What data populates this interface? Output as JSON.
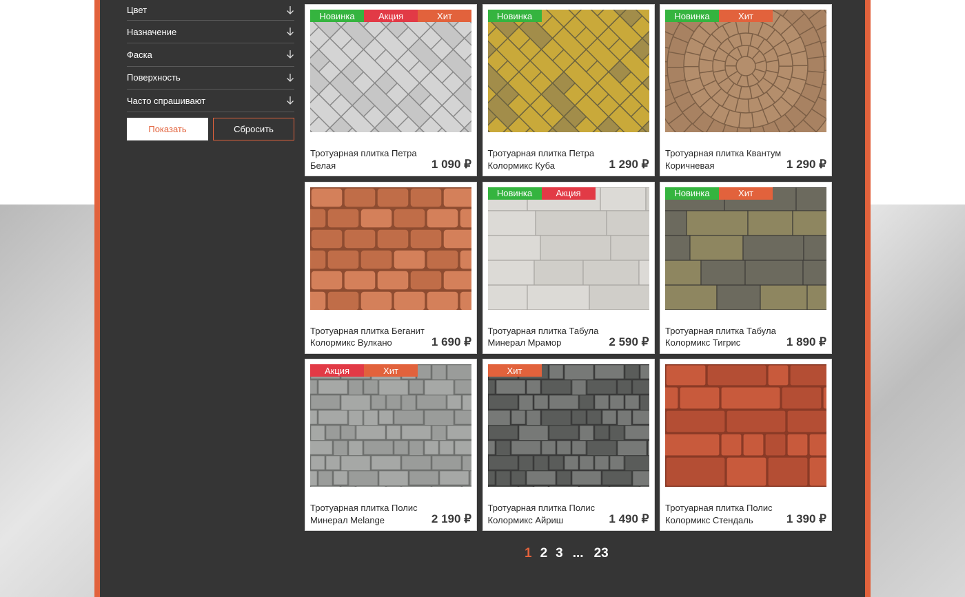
{
  "filters": [
    {
      "label": "Цвет"
    },
    {
      "label": "Назначение"
    },
    {
      "label": "Фаска"
    },
    {
      "label": "Поверхность"
    },
    {
      "label": "Часто спрашивают"
    }
  ],
  "buttons": {
    "show": "Показать",
    "reset": "Сбросить"
  },
  "badge_labels": {
    "new": "Новинка",
    "sale": "Акция",
    "hit": "Хит"
  },
  "products": [
    {
      "title": "Тротуарная плитка Петра Белая",
      "price": "1 090 ₽",
      "badges": [
        "new",
        "sale",
        "hit"
      ],
      "pattern": "herringbone",
      "colors": [
        "#d4d4d4",
        "#c6c6c6",
        "#8a8a8a"
      ]
    },
    {
      "title": "Тротуарная плитка Петра Колормикс Куба",
      "price": "1 290 ₽",
      "badges": [
        "new"
      ],
      "pattern": "herringbone",
      "colors": [
        "#c9a93a",
        "#a28d4a",
        "#6d6440"
      ]
    },
    {
      "title": "Тротуарная плитка Квантум Коричневая",
      "price": "1 290 ₽",
      "badges": [
        "new",
        "hit"
      ],
      "pattern": "circle",
      "colors": [
        "#b48e6c",
        "#a88262",
        "#7c5f46"
      ]
    },
    {
      "title": "Тротуарная плитка Беганит Колормикс Вулкано",
      "price": "1 690 ₽",
      "badges": [],
      "pattern": "brick",
      "colors": [
        "#d4805a",
        "#c06d48",
        "#8e4c31"
      ]
    },
    {
      "title": "Тротуарная плитка Табула Минерал Мрамор",
      "price": "2 590 ₽",
      "badges": [
        "new",
        "sale"
      ],
      "pattern": "slab",
      "colors": [
        "#dcdad6",
        "#d0cec9",
        "#a8a6a2"
      ]
    },
    {
      "title": "Тротуарная плитка Табула Колормикс Тигрис",
      "price": "1 890 ₽",
      "badges": [
        "new",
        "hit"
      ],
      "pattern": "slab",
      "colors": [
        "#6c6a5e",
        "#8e8660",
        "#3e3c38"
      ]
    },
    {
      "title": "Тротуарная плитка Полис Минерал Melange",
      "price": "2 190 ₽",
      "badges": [
        "sale",
        "hit"
      ],
      "pattern": "mixed",
      "colors": [
        "#a6a8a6",
        "#9a9c9a",
        "#6e706e"
      ]
    },
    {
      "title": "Тротуарная плитка Полис Колормикс Айриш",
      "price": "1 490 ₽",
      "badges": [
        "hit"
      ],
      "pattern": "mixed",
      "colors": [
        "#5a5c5a",
        "#777977",
        "#3a3b3a"
      ]
    },
    {
      "title": "Тротуарная плитка Полис Колормикс Стендаль",
      "price": "1 390 ₽",
      "badges": [],
      "pattern": "polis",
      "colors": [
        "#c85a3c",
        "#b44e34",
        "#8a3a26"
      ]
    }
  ],
  "pagination": {
    "pages": [
      "1",
      "2",
      "3",
      "...",
      "23"
    ],
    "current": "1"
  }
}
